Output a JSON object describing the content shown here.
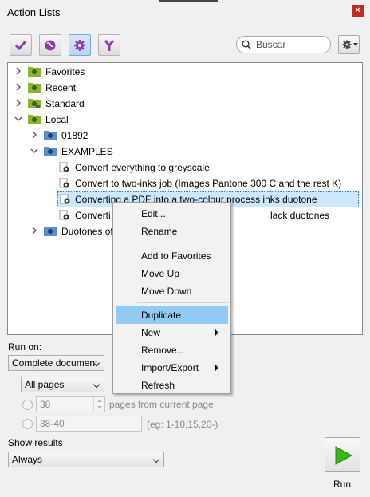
{
  "window": {
    "title": "Action Lists",
    "close_glyph": "×"
  },
  "toolbar": {
    "buttons": [
      {
        "icon": "checkmark-icon",
        "color": "#8e3fa7"
      },
      {
        "icon": "globe-icon",
        "color": "#8e3fa7"
      },
      {
        "icon": "gear-icon",
        "color": "#8e3fa7",
        "active": true
      },
      {
        "icon": "fork-icon",
        "color": "#8e3fa7"
      }
    ],
    "search_placeholder": "Buscar",
    "search_value": ""
  },
  "tree": {
    "items": [
      {
        "label": "Favorites"
      },
      {
        "label": "Recent"
      },
      {
        "label": "Standard"
      },
      {
        "label": "Local"
      },
      {
        "label": "01892"
      },
      {
        "label": "EXAMPLES"
      },
      {
        "label": "Convert everything to greyscale"
      },
      {
        "label": "Convert to two-inks job (Images Pantone 300 C and the rest K)"
      },
      {
        "label": "Converting a PDF into a two-colour process inks duotone",
        "selected": true
      },
      {
        "label": "Converti",
        "suffix": "lack duotones"
      },
      {
        "label": "Duotones of"
      }
    ]
  },
  "context_menu": {
    "items": [
      {
        "label": "Edit..."
      },
      {
        "label": "Rename"
      },
      {
        "label": "Add to Favorites"
      },
      {
        "label": "Move Up"
      },
      {
        "label": "Move Down"
      },
      {
        "label": "Duplicate",
        "highlighted": true
      },
      {
        "label": "New",
        "submenu": true
      },
      {
        "label": "Remove..."
      },
      {
        "label": "Import/Export",
        "submenu": true
      },
      {
        "label": "Refresh"
      }
    ]
  },
  "run_on": {
    "label": "Run on:",
    "document_value": "Complete document",
    "pages_value": "All pages",
    "current_page_value": "38",
    "current_page_suffix": "pages from current page",
    "range_value": "38-40",
    "range_hint": "(eg: 1-10,15,20-)"
  },
  "show_results": {
    "label": "Show results",
    "value": "Always"
  },
  "run": {
    "label": "Run"
  },
  "colors": {
    "folder_green": "#8bb52e",
    "folder_blue": "#5b8fd1",
    "selection": "#cce8ff",
    "menu_highlight": "#91c9f7",
    "run_green": "#3fb618"
  }
}
